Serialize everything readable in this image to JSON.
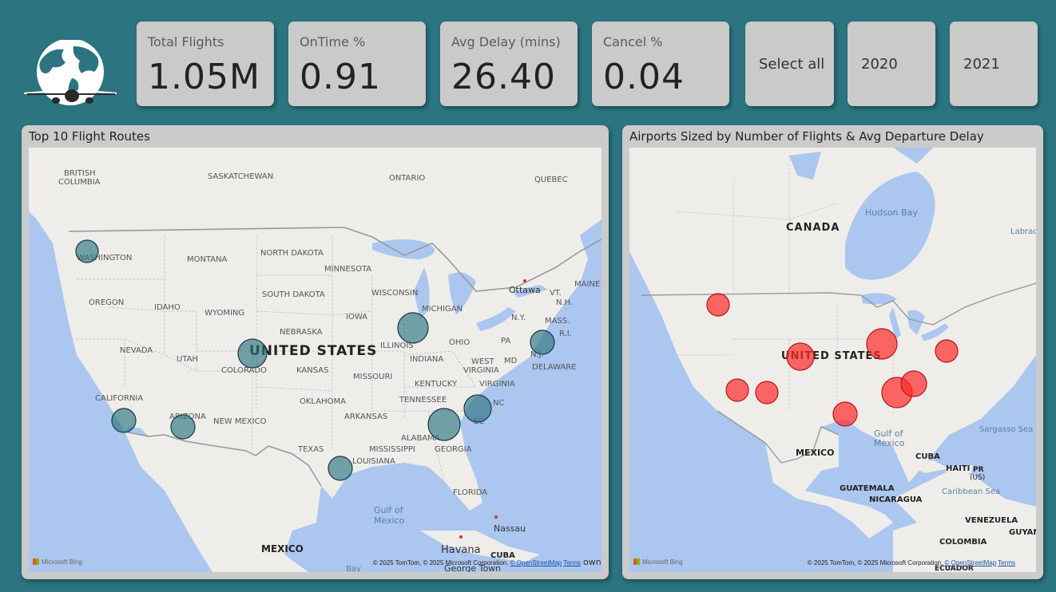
{
  "kpis": [
    {
      "label": "Total Flights",
      "value": "1.05M"
    },
    {
      "label": "OnTime %",
      "value": "0.91"
    },
    {
      "label": "Avg Delay (mins)",
      "value": "26.40"
    },
    {
      "label": "Cancel %",
      "value": "0.04"
    }
  ],
  "slicers": [
    "Select all",
    "2020",
    "2021"
  ],
  "left_map": {
    "title": "Top 10 Flight Routes",
    "bubble_color": "#2b7480",
    "labels": {
      "british_columbia_1": "BRITISH",
      "british_columbia_2": "COLUMBIA",
      "saskatchewan": "SASKATCHEWAN",
      "ontario": "ONTARIO",
      "quebec": "QUEBEC",
      "washington": "WASHINGTON",
      "montana": "MONTANA",
      "north_dakota": "NORTH DAKOTA",
      "minnesota": "MINNESOTA",
      "maine": "MAINE",
      "ottawa": "Ottawa",
      "vt": "VT.",
      "nh": "N.H.",
      "oregon": "OREGON",
      "idaho": "IDAHO",
      "wyoming": "WYOMING",
      "south_dakota": "SOUTH DAKOTA",
      "wisconsin": "WISCONSIN",
      "michigan": "MICHIGAN",
      "ny": "N.Y.",
      "mass": "MASS.",
      "ri": "R.I.",
      "iowa": "IOWA",
      "nebraska": "NEBRASKA",
      "nevada": "NEVADA",
      "utah": "UTAH",
      "colorado": "COLORADO",
      "united_states": "UNITED STATES",
      "illinois": "ILLINOIS",
      "ohio": "OHIO",
      "pa": "PA",
      "nj": "N.J.",
      "kansas": "KANSAS",
      "indiana": "INDIANA",
      "west": "WEST",
      "virginia_w": "VIRGINIA",
      "md": "MD",
      "delaware": "DELAWARE",
      "missouri": "MISSOURI",
      "kentucky": "KENTUCKY",
      "virginia": "VIRGINIA",
      "california": "CALIFORNIA",
      "oklahoma": "OKLAHOMA",
      "tennessee": "TENNESSEE",
      "nc": "NC",
      "arizona": "ARIZONA",
      "new_mexico": "NEW MEXICO",
      "arkansas": "ARKANSAS",
      "sc": "SC",
      "alabama": "ALABAMA",
      "georgia": "GEORGIA",
      "texas": "TEXAS",
      "mississippi": "MISSISSIPPI",
      "louisiana": "LOUISIANA",
      "florida": "FLORIDA",
      "gulf1": "Gulf of",
      "gulf2": "Mexico",
      "nassau": "Nassau",
      "mexico": "MEXICO",
      "havana": "Havana",
      "cuba": "CUBA",
      "george_town": "George Town",
      "own": "own",
      "bay": "Bay"
    },
    "bing": "Microsoft Bing",
    "attribution": "© 2025 TomTom, © 2025 Microsoft Corporation,",
    "osm": "© OpenStreetMap",
    "terms": "Terms"
  },
  "right_map": {
    "title": "Airports Sized by Number of Flights & Avg Departure Delay",
    "bubble_color": "#ff2b2b",
    "labels": {
      "hudson": "Hudson Bay",
      "canada": "CANADA",
      "labrador": "Labrac",
      "united_states": "UNITED STATES",
      "gulf1": "Gulf of",
      "gulf2": "Mexico",
      "sargasso": "Sargasso Sea",
      "mexico": "MEXICO",
      "cuba": "CUBA",
      "haiti": "HAITI",
      "pr": "PR",
      "us": "(US)",
      "caribbean": "Caribbean Sea",
      "guatemala": "GUATEMALA",
      "nicaragua": "NICARAGUA",
      "venezuela": "VENEZUELA",
      "guyana": "GUYANA",
      "colombia": "COLOMBIA",
      "ecuador": "ECUADOR"
    },
    "bing": "Microsoft Bing",
    "attribution": "© 2025 TomTom, © 2025 Microsoft Corporation,",
    "osm": "© OpenStreetMap",
    "terms": "Terms"
  }
}
